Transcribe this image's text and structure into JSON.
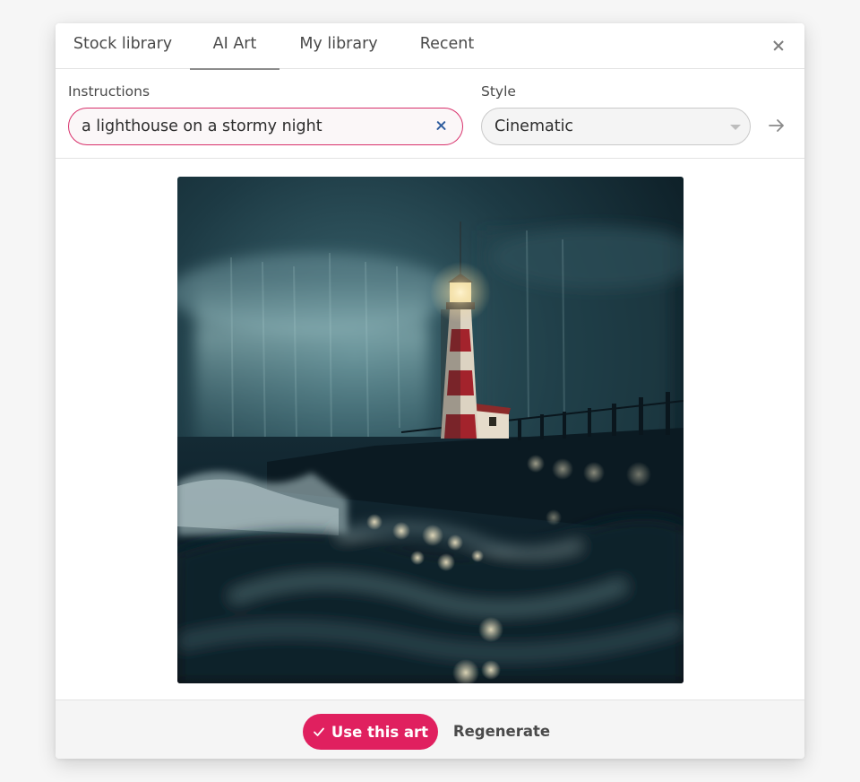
{
  "tabs": [
    {
      "label": "Stock library"
    },
    {
      "label": "AI Art"
    },
    {
      "label": "My library"
    },
    {
      "label": "Recent"
    }
  ],
  "active_tab": "AI Art",
  "form": {
    "instructions_label": "Instructions",
    "instructions_value": "a lighthouse on a stormy night",
    "style_label": "Style",
    "style_value": "Cinematic"
  },
  "footer": {
    "use_label": "Use this art",
    "regenerate_label": "Regenerate"
  },
  "colors": {
    "accent": "#e0205f",
    "input_border": "#d8306b",
    "clear_icon": "#2f5d9e"
  },
  "icons": {
    "close": "close-icon",
    "clear": "clear-icon",
    "submit": "arrow-right-icon",
    "confirm": "check-icon",
    "dropdown": "chevron-down-icon"
  }
}
